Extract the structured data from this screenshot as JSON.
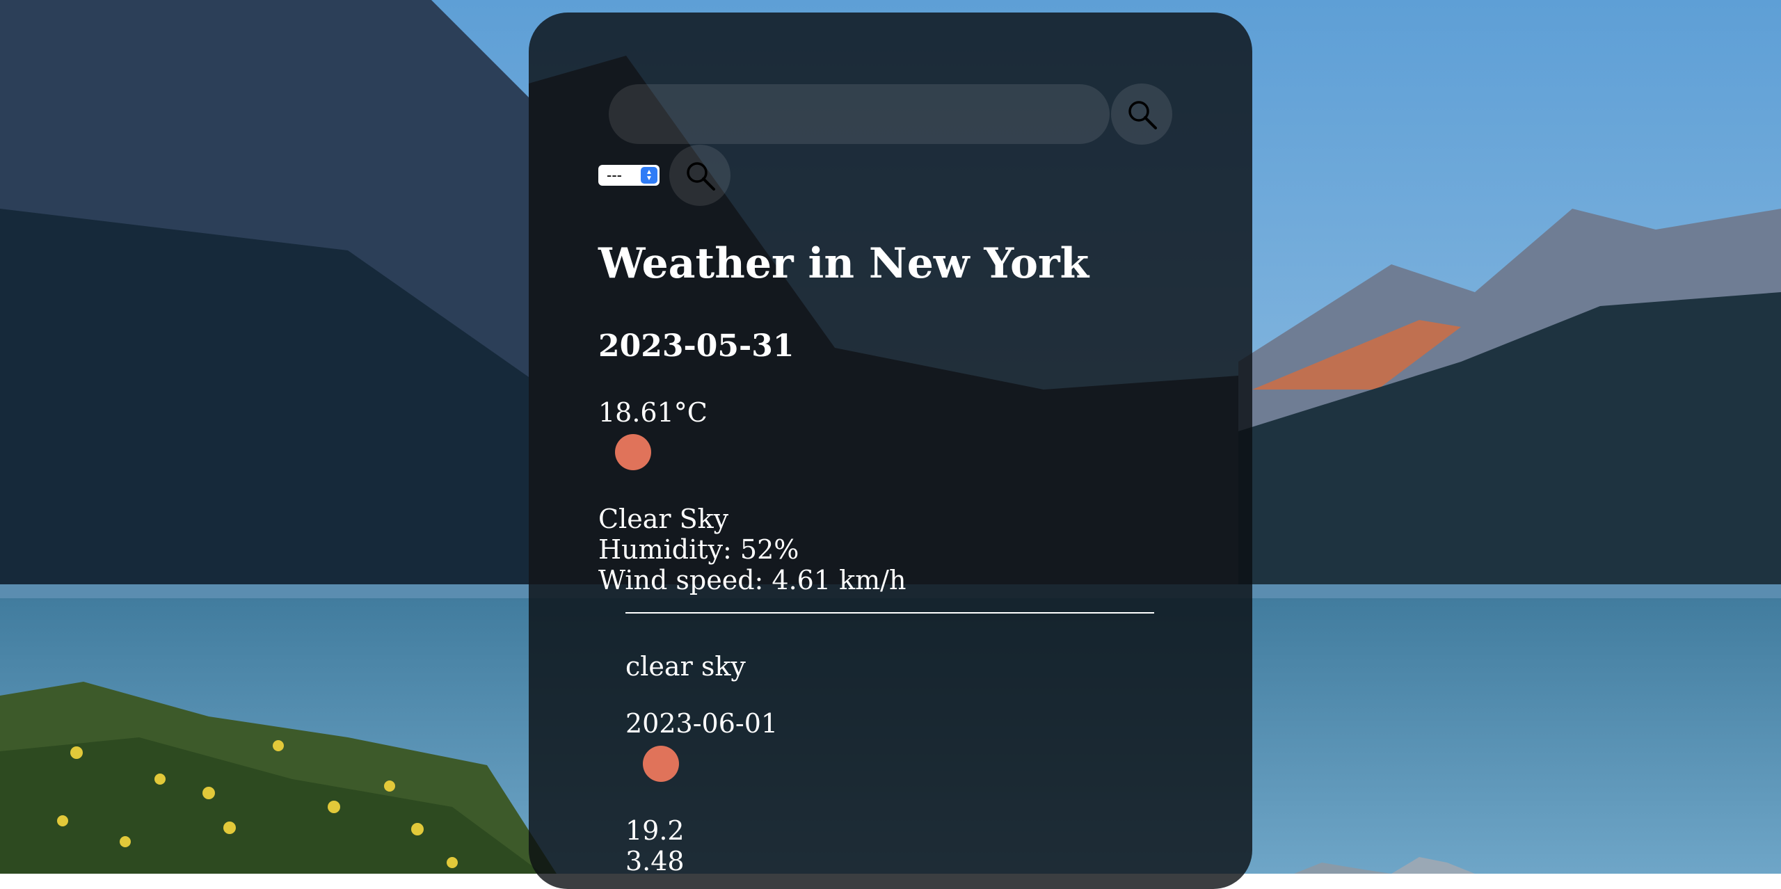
{
  "search": {
    "placeholder": "",
    "value": ""
  },
  "select": {
    "selected": "---"
  },
  "current": {
    "title": "Weather in New York",
    "date": "2023-05-31",
    "temperature": "18.61°C",
    "description": " Clear Sky",
    "humidity": "Humidity: 52%",
    "wind": "Wind speed: 4.61 km/h",
    "weather_icon": "sun-icon"
  },
  "forecast": [
    {
      "description": "clear sky",
      "date": "2023-06-01",
      "temp": "19.2",
      "wind": "3.48",
      "weather_icon": "sun-icon"
    }
  ],
  "colors": {
    "accent": "#e0735a",
    "card": "#0a0e12",
    "select_accent": "#2f7cf6"
  }
}
